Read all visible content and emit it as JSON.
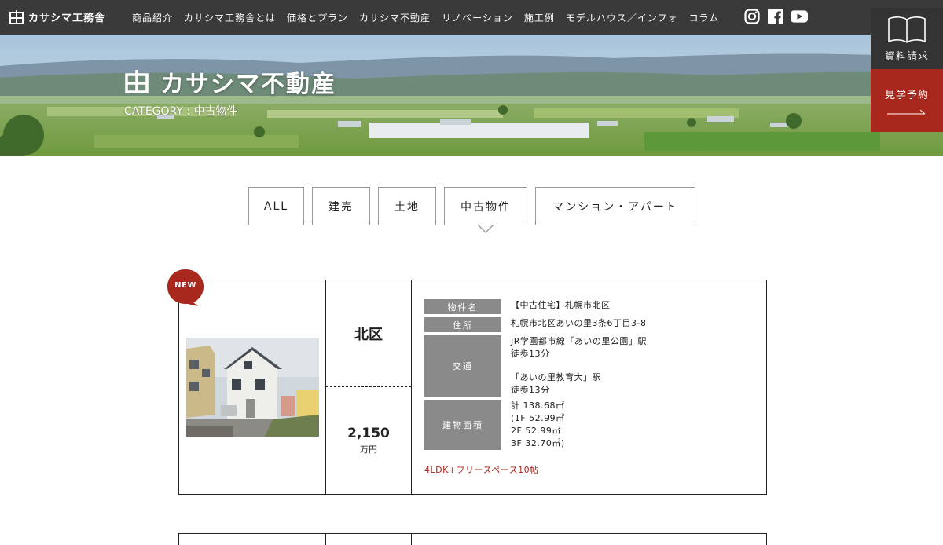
{
  "header": {
    "logo_text": "カサシマ工務舎",
    "nav": [
      "商品紹介",
      "カサシマ工務舎とは",
      "価格とプラン",
      "カサシマ不動産",
      "リノベーション",
      "施工例",
      "モデルハウス／インフォ",
      "コラム"
    ],
    "social": [
      "instagram-icon",
      "facebook-icon",
      "youtube-icon"
    ]
  },
  "side_buttons": {
    "document_request": "資料請求",
    "visit_reservation": "見学予約"
  },
  "hero": {
    "title": "カサシマ不動産",
    "category": "CATEGORY : 中古物件"
  },
  "tabs": [
    {
      "label": "ALL",
      "active": false
    },
    {
      "label": "建売",
      "active": false
    },
    {
      "label": "土地",
      "active": false
    },
    {
      "label": "中古物件",
      "active": true
    },
    {
      "label": "マンション・アパート",
      "active": false
    }
  ],
  "listing": {
    "badge": "NEW",
    "area": "北区",
    "price": "2,150",
    "price_unit": "万円",
    "fields": {
      "name_key": "物件名",
      "name_val": "【中古住宅】札幌市北区",
      "address_key": "住所",
      "address_val": "札幌市北区あいの里3条6丁目3-8",
      "access_key": "交通",
      "access_lines": [
        "JR学園都市線「あいの里公園」駅",
        "徒歩13分",
        "「あいの里教育大」駅",
        "徒歩13分"
      ],
      "floor_key": "建物面積",
      "floor_lines": [
        "計 138.68㎡",
        "(1F 52.99㎡",
        "2F 52.99㎡",
        "3F 32.70㎡)"
      ]
    },
    "plan": "4LDK+フリースペース10帖"
  },
  "colors": {
    "header_bg": "#3a3a3a",
    "accent_red": "#a8281e",
    "label_gray": "#8a8a8a"
  }
}
